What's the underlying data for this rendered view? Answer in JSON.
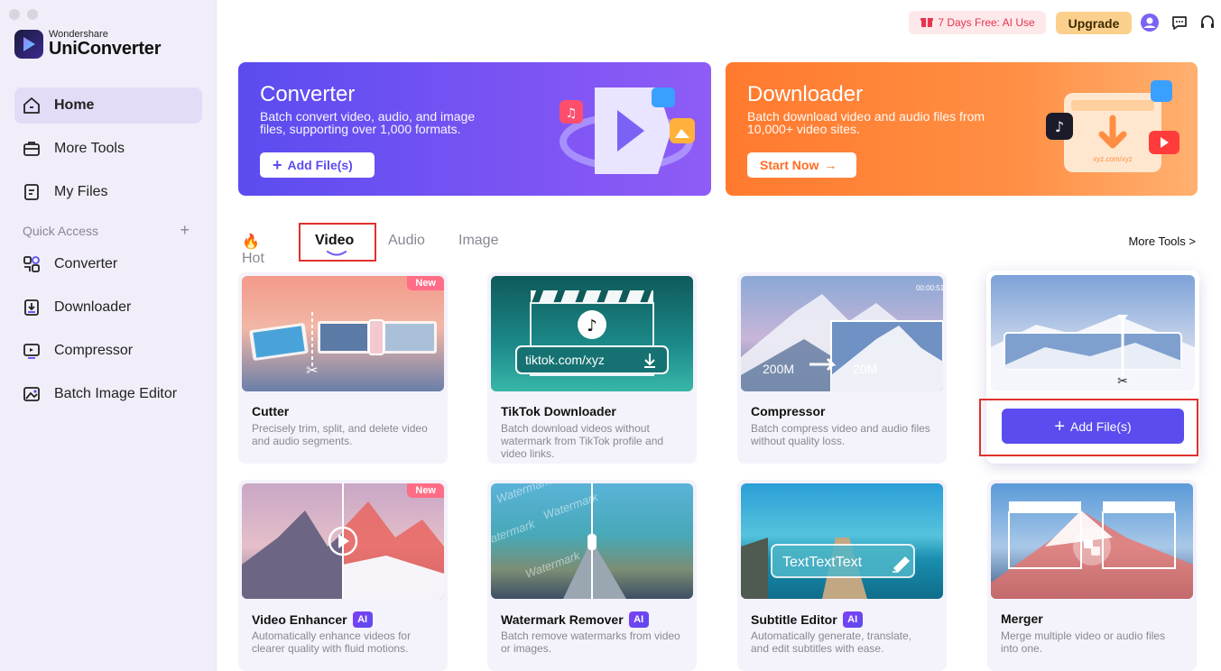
{
  "app": {
    "brand_small": "Wondershare",
    "brand_big": "UniConverter"
  },
  "sidebar": {
    "items": [
      {
        "label": "Home",
        "icon": "home-icon",
        "active": true
      },
      {
        "label": "More Tools",
        "icon": "toolbox-icon"
      },
      {
        "label": "My Files",
        "icon": "file-icon"
      }
    ],
    "quick_access_label": "Quick Access",
    "quick_access": [
      {
        "label": "Converter",
        "icon": "converter-icon"
      },
      {
        "label": "Downloader",
        "icon": "downloader-icon"
      },
      {
        "label": "Compressor",
        "icon": "compressor-icon"
      },
      {
        "label": "Batch Image Editor",
        "icon": "image-editor-icon"
      }
    ]
  },
  "topbar": {
    "trial_label": "7 Days Free: AI Use",
    "upgrade_label": "Upgrade"
  },
  "banners": {
    "converter": {
      "title": "Converter",
      "desc": "Batch convert video, audio, and image files, supporting over 1,000 formats.",
      "button": "Add File(s)"
    },
    "downloader": {
      "title": "Downloader",
      "desc": "Batch download video and audio files from 10,000+ video sites.",
      "button": "Start Now",
      "url_text": "xyz.com/xyz"
    }
  },
  "tabs": {
    "hot": "Hot",
    "video": "Video",
    "audio": "Audio",
    "image": "Image",
    "more_tools": "More Tools >"
  },
  "cards": [
    {
      "title": "Cutter",
      "desc": "Precisely trim, split, and delete video and audio segments.",
      "badge": "New"
    },
    {
      "title": "TikTok Downloader",
      "desc": "Batch download videos without watermark from TikTok profile and video links.",
      "thumb_text": "tiktok.com/xyz"
    },
    {
      "title": "Compressor",
      "desc": "Batch compress video and audio files without quality loss.",
      "from": "200M",
      "to": "20M",
      "time": "00:00:51"
    },
    {
      "title": "Merger",
      "desc": "Merge multiple video or audio files into one.",
      "button": "Add File(s)"
    },
    {
      "title": "Video Enhancer",
      "desc": "Automatically enhance videos for clearer quality with fluid motions.",
      "badge": "New",
      "ai": "AI"
    },
    {
      "title": "Watermark Remover",
      "desc": "Batch remove watermarks from video or images.",
      "ai": "AI",
      "wm": "Watermark"
    },
    {
      "title": "Subtitle Editor",
      "desc": "Automatically generate, translate, and edit subtitles with ease.",
      "ai": "AI",
      "thumb_text": "TextTextText"
    },
    {
      "title": "Merger",
      "desc": "Merge multiple video or audio files into one."
    }
  ],
  "colors": {
    "accent": "#5b4cf0",
    "orange": "#ff7a2e",
    "highlight_red": "#e0312d"
  }
}
